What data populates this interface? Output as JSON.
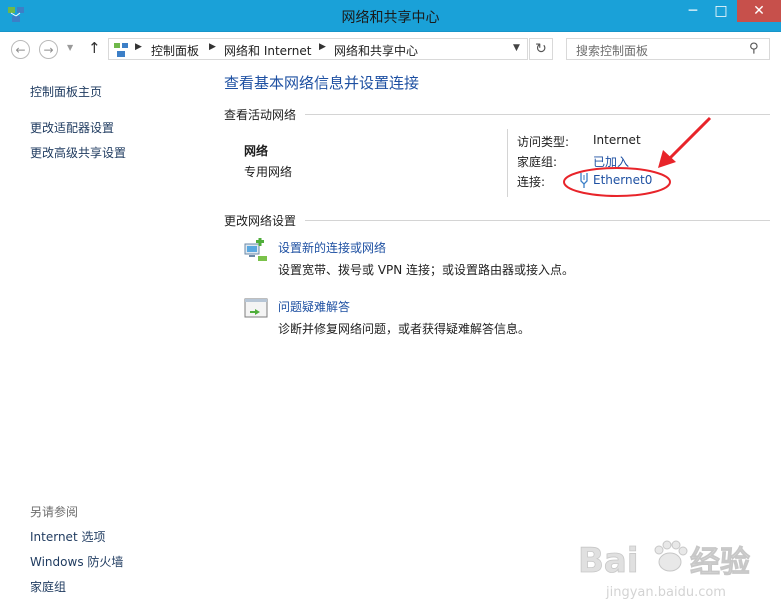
{
  "window": {
    "title": "网络和共享中心",
    "minimize_glyph": "─",
    "maximize_glyph": "□",
    "close_glyph": "✕"
  },
  "address_bar": {
    "back_glyph": "←",
    "forward_glyph": "→",
    "up_glyph": "↑",
    "refresh_glyph": "↻",
    "breadcrumb": [
      "控制面板",
      "网络和 Internet",
      "网络和共享中心"
    ],
    "search_placeholder": "搜索控制面板"
  },
  "sidebar": {
    "home": "控制面板主页",
    "links": [
      "更改适配器设置",
      "更改高级共享设置"
    ],
    "see_also_title": "另请参阅",
    "see_also": [
      "Internet 选项",
      "Windows 防火墙",
      "家庭组"
    ]
  },
  "main": {
    "title": "查看基本网络信息并设置连接",
    "active_networks_heading": "查看活动网络",
    "network": {
      "name": "网络",
      "profile": "专用网络",
      "access_type_label": "访问类型:",
      "access_type_value": "Internet",
      "homegroup_label": "家庭组:",
      "homegroup_value": "已加入",
      "connections_label": "连接:",
      "connections_value": "Ethernet0"
    },
    "change_settings_heading": "更改网络设置",
    "tasks": [
      {
        "link": "设置新的连接或网络",
        "desc": "设置宽带、拨号或 VPN 连接；或设置路由器或接入点。",
        "icon": "network-setup-icon"
      },
      {
        "link": "问题疑难解答",
        "desc": "诊断并修复网络问题，或者获得疑难解答信息。",
        "icon": "troubleshoot-icon"
      }
    ]
  },
  "watermark": {
    "brand": "Bai",
    "brand2": "经验",
    "url": "jingyan.baidu.com"
  },
  "colors": {
    "titlebar": "#1aa1d8",
    "close_button": "#c7504b",
    "link": "#1e50a2",
    "annotation": "#e8242a"
  }
}
